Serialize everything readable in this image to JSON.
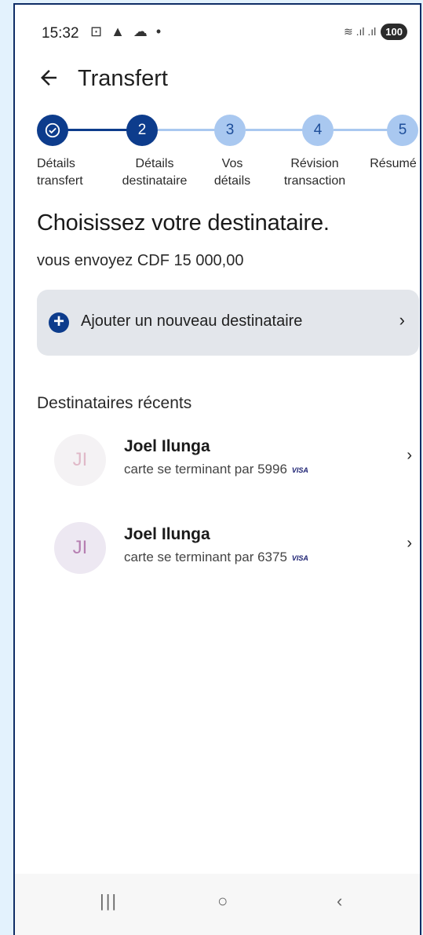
{
  "status_bar": {
    "time": "15:32",
    "left_icons": "⊡ ▲ ☁ •",
    "signal": "≋ .ıl .ıl",
    "battery": "100"
  },
  "app_bar": {
    "title": "Transfert"
  },
  "steps": [
    {
      "number": "",
      "label_line1": "Détails",
      "label_line2": "transfert",
      "state": "done"
    },
    {
      "number": "2",
      "label_line1": "Détails",
      "label_line2": "destinataire",
      "state": "active"
    },
    {
      "number": "3",
      "label_line1": "Vos",
      "label_line2": "détails",
      "state": "todo"
    },
    {
      "number": "4",
      "label_line1": "Révision",
      "label_line2": "transaction",
      "state": "todo"
    },
    {
      "number": "5",
      "label_line1": "Résumé",
      "label_line2": "",
      "state": "todo"
    }
  ],
  "main": {
    "heading": "Choisissez votre destinataire.",
    "subheading": "vous envoyez CDF 15 000,00",
    "add_recipient_label": "Ajouter un nouveau destinataire",
    "recent_title": "Destinataires récents"
  },
  "recipients": [
    {
      "initials": "JI",
      "name": "Joel  Ilunga",
      "detail": "carte se terminant par 5996",
      "card_brand": "VISA"
    },
    {
      "initials": "JI",
      "name": "Joel Ilunga",
      "detail": "carte se terminant par 6375",
      "card_brand": "VISA"
    }
  ],
  "colors": {
    "primary": "#0d3c8c",
    "step_todo": "#a9c8f0",
    "background": "#e3f2fd",
    "card_bg": "#e3e6eb"
  }
}
